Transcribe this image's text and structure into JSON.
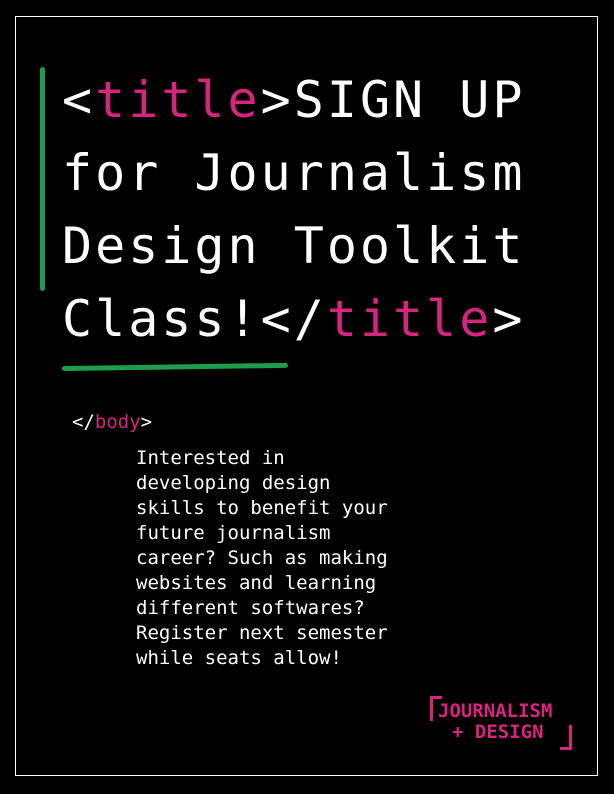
{
  "headline": {
    "open_tag_lt": "<",
    "open_tag_name": "title",
    "open_tag_gt": ">",
    "line1_text": "SIGN UP",
    "line2_text": "for Journalism",
    "line3_text": "Design Toolkit",
    "line4_text": "Class!",
    "close_tag_lt": "</",
    "close_tag_name": "title",
    "close_tag_gt": ">"
  },
  "body_tag": {
    "lt": "</",
    "name": "body",
    "gt": ">"
  },
  "paragraph": {
    "lines": [
      "Interested in",
      "developing design",
      "skills to benefit your",
      "future journalism",
      "career? Such as making",
      "websites and learning",
      "different softwares?",
      "Register next semester",
      "while seats allow!"
    ]
  },
  "logo": {
    "line1": "JOURNALISM",
    "line2": "+ DESIGN"
  },
  "colors": {
    "background": "#000000",
    "text": "#ffffff",
    "accent_pink": "#d6247f",
    "accent_green": "#1e9e4c"
  }
}
